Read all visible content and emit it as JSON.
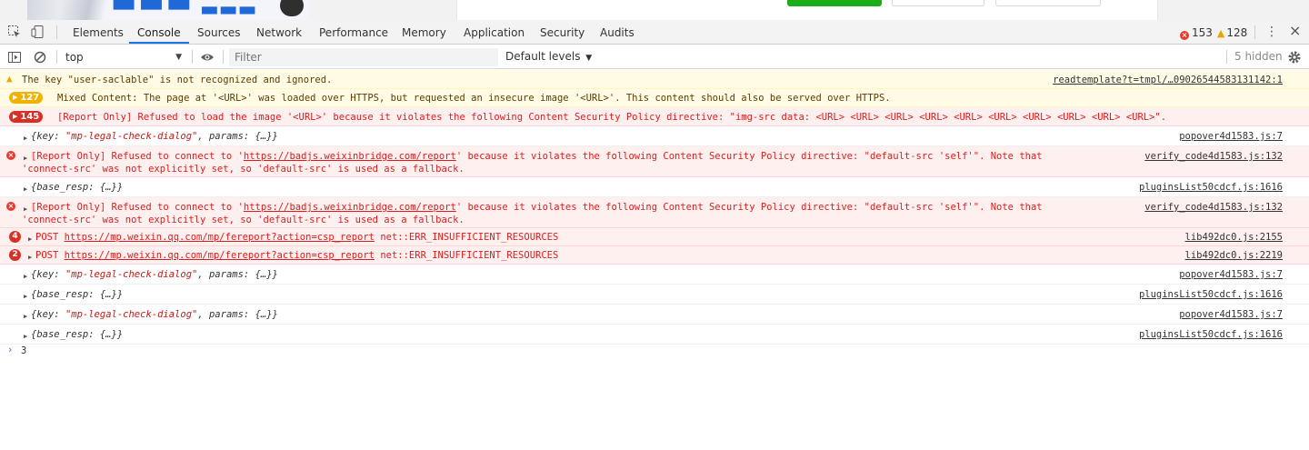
{
  "devtools": {
    "tabs": [
      {
        "label": "Elements"
      },
      {
        "label": "Console"
      },
      {
        "label": "Sources"
      },
      {
        "label": "Network"
      },
      {
        "label": "Performance"
      },
      {
        "label": "Memory"
      },
      {
        "label": "Application"
      },
      {
        "label": "Security"
      },
      {
        "label": "Audits"
      }
    ],
    "active_tab": "Console",
    "error_count": "153",
    "warning_count": "128",
    "accent": "#1a73e8"
  },
  "filterbar": {
    "context": "top",
    "filter_placeholder": "Filter",
    "levels": "Default levels",
    "hidden": "5 hidden"
  },
  "messages": [
    {
      "kind": "warn",
      "text": "The key \"user-saclable\" is not recognized and ignored.",
      "source": "readtemplate?t=tmpl/…09026544583131142:1"
    },
    {
      "kind": "warn-group",
      "count": "127",
      "text": "Mixed Content: The page at '<URL>' was loaded over HTTPS, but requested an insecure image '<URL>'. This content should also be served over HTTPS."
    },
    {
      "kind": "error-group",
      "count": "145",
      "text": "[Report Only] Refused to load the image '<URL>' because it violates the following Content Security Policy directive: \"img-src data: <URL> <URL> <URL> <URL> <URL> <URL> <URL> <URL> <URL> <URL>\"."
    },
    {
      "kind": "object",
      "pre": "{key: ",
      "str": "\"mp-legal-check-dialog\"",
      "post": ", params: {…}}",
      "source": "popover4d1583.js:7"
    },
    {
      "kind": "error",
      "line1_pre": "[Report Only] Refused to connect to '",
      "url": "https://badjs.weixinbridge.com/report",
      "line1_post": "' because it violates the following Content Security Policy directive: \"default-src 'self'\". Note that",
      "line2": "'connect-src' was not explicitly set, so 'default-src' is used as a fallback.",
      "source": "verify_code4d1583.js:132"
    },
    {
      "kind": "object",
      "pre": "{base_resp: {…}}",
      "str": "",
      "post": "",
      "source": "pluginsList50cdcf.js:1616"
    },
    {
      "kind": "error",
      "line1_pre": "[Report Only] Refused to connect to '",
      "url": "https://badjs.weixinbridge.com/report",
      "line1_post": "' because it violates the following Content Security Policy directive: \"default-src 'self'\". Note that",
      "line2": "'connect-src' was not explicitly set, so 'default-src' is used as a fallback.",
      "source": "verify_code4d1583.js:132"
    },
    {
      "kind": "net",
      "count": "4",
      "method": "POST",
      "url": "https://mp.weixin.qq.com/mp/fereport?action=csp_report",
      "err": "net::ERR_INSUFFICIENT_RESOURCES",
      "source": "lib492dc0.js:2155"
    },
    {
      "kind": "net",
      "count": "2",
      "method": "POST",
      "url": "https://mp.weixin.qq.com/mp/fereport?action=csp_report",
      "err": "net::ERR_INSUFFICIENT_RESOURCES",
      "source": "lib492dc0.js:2219"
    },
    {
      "kind": "object",
      "pre": "{key: ",
      "str": "\"mp-legal-check-dialog\"",
      "post": ", params: {…}}",
      "source": "popover4d1583.js:7"
    },
    {
      "kind": "object",
      "pre": "{base_resp: {…}}",
      "str": "",
      "post": "",
      "source": "pluginsList50cdcf.js:1616"
    },
    {
      "kind": "object",
      "pre": "{key: ",
      "str": "\"mp-legal-check-dialog\"",
      "post": ", params: {…}}",
      "source": "popover4d1583.js:7"
    },
    {
      "kind": "object",
      "pre": "{base_resp: {…}}",
      "str": "",
      "post": "",
      "source": "pluginsList50cdcf.js:1616"
    }
  ],
  "prompt": {
    "result": "3"
  }
}
